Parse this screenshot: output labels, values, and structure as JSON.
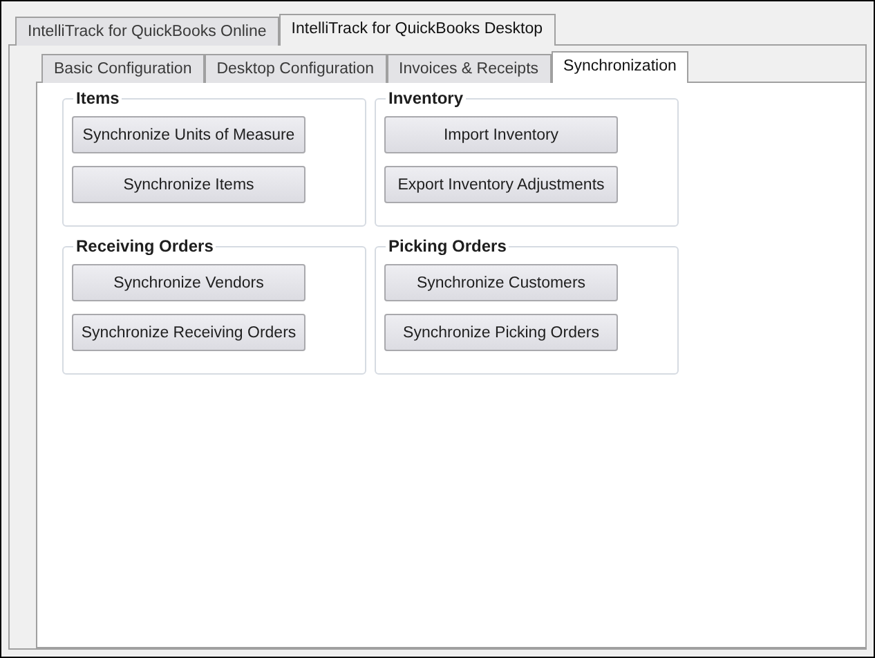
{
  "outer_tabs": [
    {
      "label": "IntelliTrack for QuickBooks Online",
      "selected": false
    },
    {
      "label": "IntelliTrack for QuickBooks Desktop",
      "selected": true
    }
  ],
  "inner_tabs": [
    {
      "label": "Basic Configuration",
      "selected": false
    },
    {
      "label": "Desktop Configuration",
      "selected": false
    },
    {
      "label": "Invoices & Receipts",
      "selected": false
    },
    {
      "label": "Synchronization",
      "selected": true
    }
  ],
  "groups": [
    {
      "title": "Items",
      "buttons": [
        "Synchronize Units of Measure",
        "Synchronize Items"
      ]
    },
    {
      "title": "Inventory",
      "buttons": [
        "Import Inventory",
        "Export Inventory Adjustments"
      ]
    },
    {
      "title": "Receiving Orders",
      "buttons": [
        "Synchronize Vendors",
        "Synchronize Receiving Orders"
      ]
    },
    {
      "title": "Picking Orders",
      "buttons": [
        "Synchronize Customers",
        "Synchronize Picking Orders"
      ]
    }
  ]
}
